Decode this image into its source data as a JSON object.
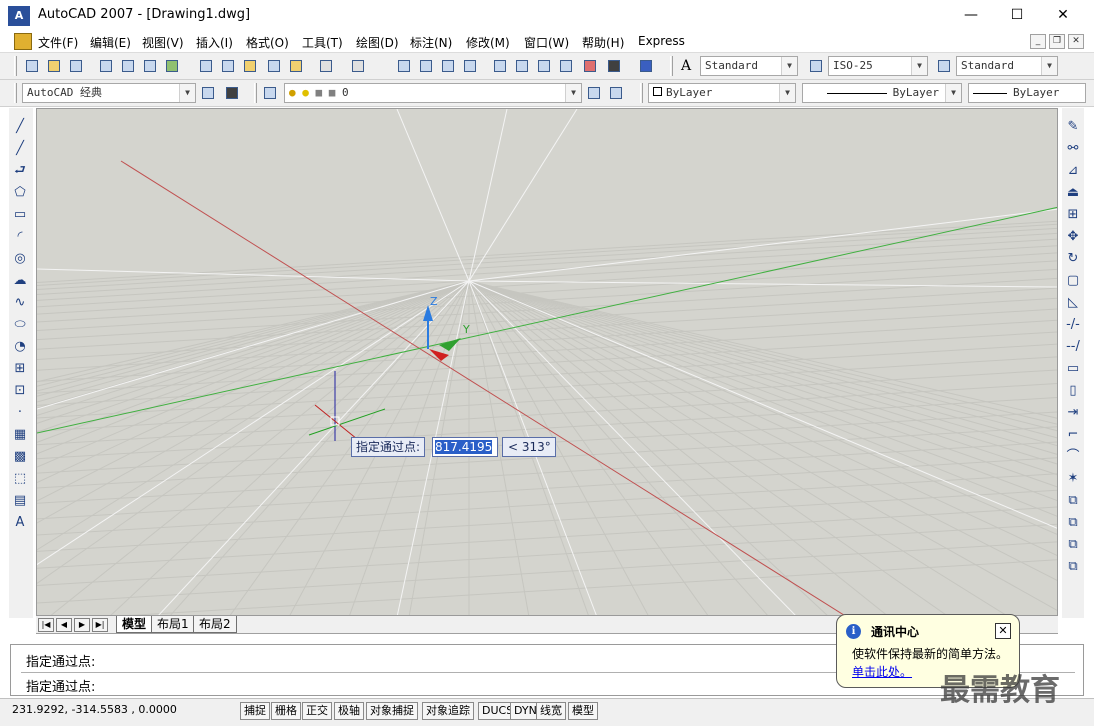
{
  "window": {
    "app_icon": "A",
    "title": "AutoCAD 2007 - [Drawing1.dwg]",
    "minimize": "—",
    "maximize": "☐",
    "close": "✕"
  },
  "menu": {
    "items": [
      "文件(F)",
      "编辑(E)",
      "视图(V)",
      "插入(I)",
      "格式(O)",
      "工具(T)",
      "绘图(D)",
      "标注(N)",
      "修改(M)",
      "窗口(W)",
      "帮助(H)",
      "Express"
    ],
    "mdi_minimize": "_",
    "mdi_restore": "❐",
    "mdi_close": "✕"
  },
  "toolbar": {
    "text_style": "Standard",
    "dim_style": "ISO-25",
    "table_style": "Standard",
    "workspace": "AutoCAD 经典",
    "layer": "0",
    "color": "ByLayer",
    "linetype": "ByLayer",
    "lineweight": "ByLayer",
    "text_style_icon": "A"
  },
  "canvas": {
    "axis_z": "Z",
    "axis_y": "Y",
    "dynamic_prompt": "指定通过点:",
    "dynamic_value": "817.4195",
    "dynamic_angle": "< 313°",
    "bg_color": "#d4d4ce"
  },
  "left_tools": [
    "╱",
    "╱",
    "⮐",
    "⬠",
    "▭",
    "◜",
    "◎",
    "☁",
    "∿",
    "⬭",
    "◔",
    "⊞",
    "⊡",
    "·",
    "▦",
    "▩",
    "⬚",
    "▤",
    "A"
  ],
  "right_tools": [
    "✎",
    "⚯",
    "⊿",
    "⏏",
    "⊞",
    "✥",
    "↻",
    "▢",
    "◺",
    "-/-",
    "--/",
    "▭",
    "▯",
    "⇥",
    "⌐",
    "⌒",
    "✶",
    "⧉",
    "⧉",
    "⧉",
    "⧉"
  ],
  "tabs": {
    "nav": [
      "|◀",
      "◀",
      "▶",
      "▶|"
    ],
    "items": [
      "模型",
      "布局1",
      "布局2"
    ]
  },
  "command": {
    "line1": "指定通过点:",
    "line2": "指定通过点:"
  },
  "status": {
    "coords": "231.9292, -314.5583 , 0.0000",
    "buttons": [
      "捕捉",
      "栅格",
      "正交",
      "极轴",
      "对象捕捉",
      "对象追踪",
      "DUCS",
      "DYN",
      "线宽",
      "模型"
    ]
  },
  "balloon": {
    "icon": "i",
    "title": "通讯中心",
    "body": "使软件保持最新的简单方法。",
    "link": "单击此处。",
    "close": "✕"
  },
  "watermark": "最需教育"
}
